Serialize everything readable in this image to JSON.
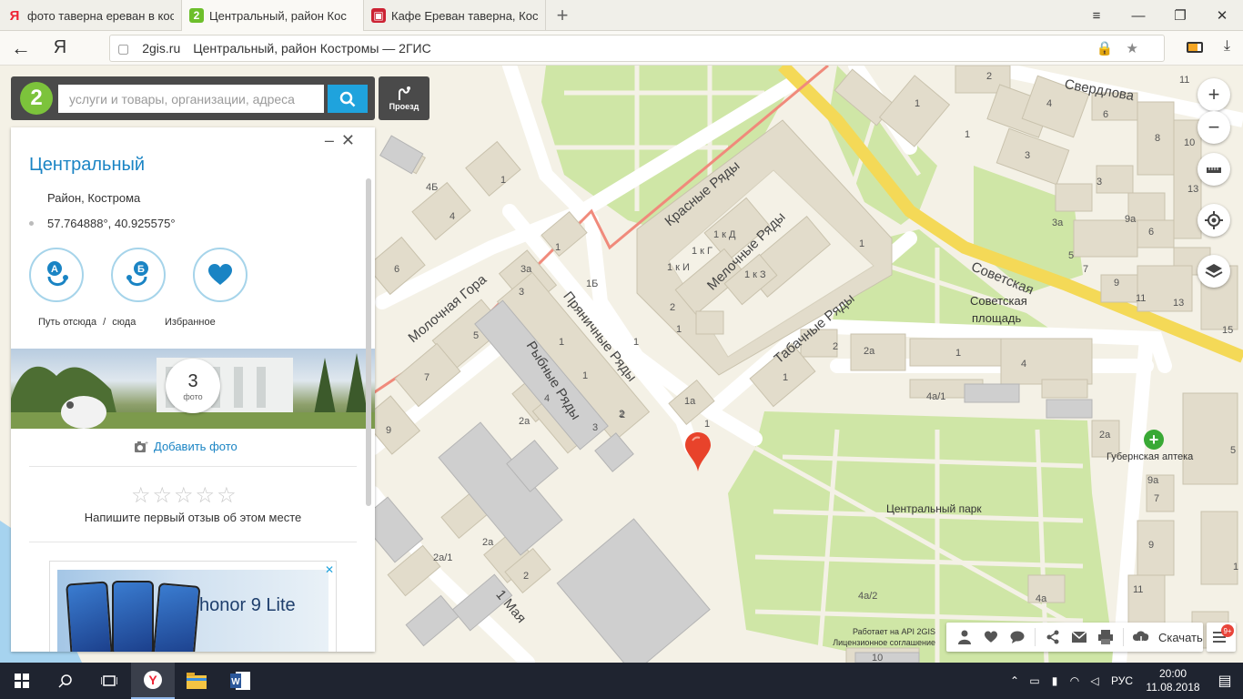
{
  "browser": {
    "tabs": [
      {
        "icon": "yandex-icon",
        "title": "фото таверна ереван в кос"
      },
      {
        "icon": "2gis-icon",
        "title": "Центральный, район Кос"
      },
      {
        "icon": "cafe-icon",
        "title": "Кафе Ереван таверна, Кост"
      }
    ],
    "new_tab": "+",
    "address": {
      "yandex": "Я",
      "domain": "2gis.ru",
      "page_title": "Центральный, район Костромы — 2ГИС"
    }
  },
  "search": {
    "placeholder": "услуги и товары, организации, адреса",
    "route_label": "Проезд"
  },
  "place": {
    "title": "Центральный",
    "subtitle": "Район, Кострома",
    "coords": "57.764888°, 40.925575°",
    "actions": {
      "route_from": "Путь отсюда",
      "route_sep": "/",
      "route_to": "сюда",
      "favorite": "Избранное"
    },
    "route_a": "А",
    "route_b": "Б",
    "photos": {
      "count": "3",
      "label": "фото"
    },
    "add_photo": "Добавить фото",
    "review_cta": "Напишите первый отзыв об этом месте",
    "stars": "☆☆☆☆☆",
    "ad": {
      "brand": "honor 9 Lite",
      "close": "✕"
    }
  },
  "map": {
    "streets": {
      "krasnye": "Красные Ряды",
      "molochnaya": "Молочная Гора",
      "ryb": "Рыбные Ряды",
      "pryan": "Пряничные Ряды",
      "moloch_ryady": "Мелочные Ряды",
      "tabach": "Табачные Ряды",
      "sovetskaya": "Советская",
      "sverdlova": "Свердлова",
      "maya": "1 Мая"
    },
    "places": {
      "sov_ploshad_1": "Советская",
      "sov_ploshad_2": "площадь",
      "park": "Центральный парк",
      "apteka": "Губернская аптека"
    },
    "numbers": [
      "1",
      "4Б",
      "4",
      "6",
      "1",
      "3а",
      "3",
      "5",
      "7",
      "9",
      "1",
      "1",
      "4",
      "3",
      "2",
      "2а",
      "2а",
      "2а/1",
      "2",
      "1Б",
      "1",
      "2",
      "1",
      "1а",
      "1",
      "1 к Д",
      "1 к Г",
      "1 к И",
      "1 к З",
      "2",
      "1",
      "1",
      "2",
      "2а",
      "1",
      "4",
      "4а/1",
      "2а",
      "4а/2",
      "4а",
      "10",
      "1",
      "1",
      "3",
      "2",
      "4",
      "6",
      "3",
      "8",
      "10",
      "13",
      "6",
      "11",
      "9а",
      "3а",
      "5",
      "7",
      "9",
      "11",
      "13",
      "15",
      "9а",
      "7",
      "9",
      "11",
      "1",
      "5"
    ],
    "license_1": "Работает на API 2GIS",
    "license_2": "Лицензионное соглашение",
    "download": "Скачать",
    "notif": "9+",
    "zoom_in": "+",
    "zoom_out": "−"
  },
  "taskbar": {
    "lang": "РУС",
    "time": "20:00",
    "date": "11.08.2018"
  },
  "colors": {
    "accent": "#1fa3dd",
    "brand_2gis": "#7cc33b",
    "pin": "#e8432b",
    "park": "#cfe6a6",
    "road_major": "#f4d957"
  }
}
